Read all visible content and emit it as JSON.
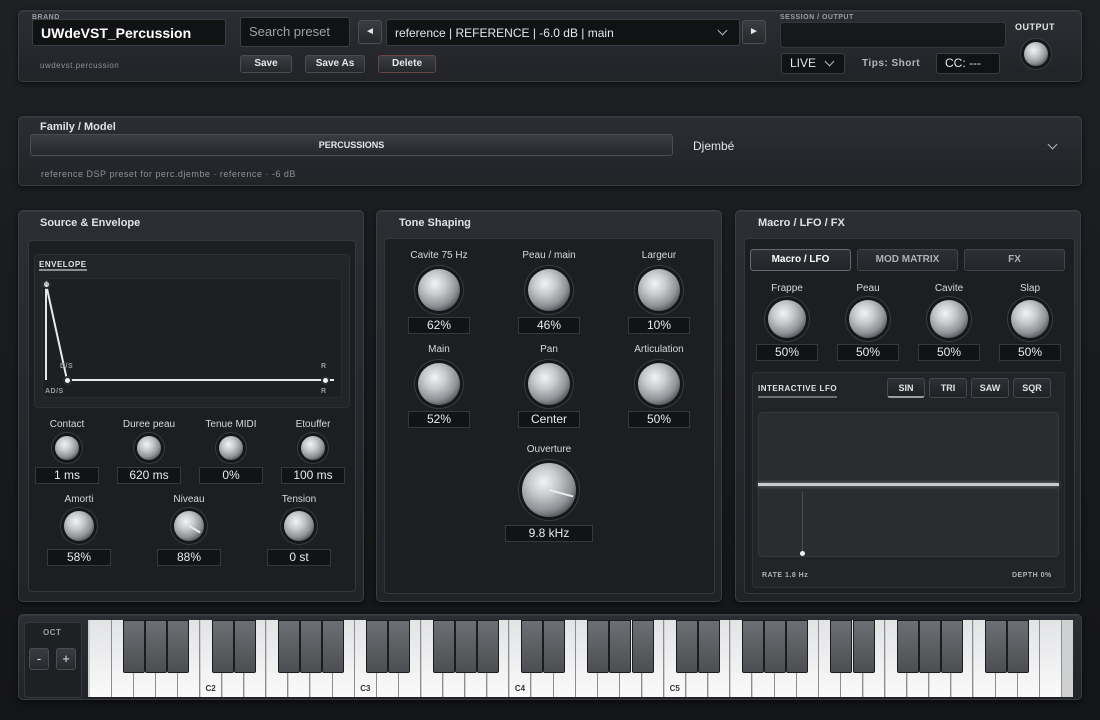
{
  "header": {
    "brand_label": "BRAND",
    "brand_name": "UWdeVST_Percussion",
    "brand_id": "uwdevst.percussion",
    "search_placeholder": "Search preset",
    "preset_name": "reference | REFERENCE | -6.0 dB | main",
    "prev_glyph": "◄",
    "next_glyph": "►",
    "save": "Save",
    "save_as": "Save As",
    "delete": "Delete",
    "session_label": "SESSION / OUTPUT",
    "mode": "LIVE",
    "tips": "Tips: Short",
    "cc": "CC: ---",
    "output_label": "OUTPUT"
  },
  "family": {
    "title": "Family / Model",
    "category": "PERCUSSIONS",
    "model": "Djembé",
    "description": "reference DSP preset for perc.djembe · reference · -6 dB"
  },
  "source": {
    "title": "Source & Envelope",
    "envelope_label": "ENVELOPE",
    "env_points": {
      "a": "A",
      "ds": "D/S",
      "ads": "AD/S",
      "r1": "R",
      "r2": "R"
    },
    "knobs": [
      {
        "label": "Contact",
        "value": "1 ms"
      },
      {
        "label": "Duree peau",
        "value": "620 ms"
      },
      {
        "label": "Tenue MIDI",
        "value": "0%"
      },
      {
        "label": "Etouffer",
        "value": "100 ms"
      },
      {
        "label": "Amorti",
        "value": "58%"
      },
      {
        "label": "Niveau",
        "value": "88%"
      },
      {
        "label": "Tension",
        "value": "0 st"
      }
    ]
  },
  "tone": {
    "title": "Tone Shaping",
    "knobs": [
      {
        "label": "Cavite 75 Hz",
        "value": "62%"
      },
      {
        "label": "Peau / main",
        "value": "46%"
      },
      {
        "label": "Largeur",
        "value": "10%"
      },
      {
        "label": "Main",
        "value": "52%"
      },
      {
        "label": "Pan",
        "value": "Center"
      },
      {
        "label": "Articulation",
        "value": "50%"
      },
      {
        "label": "Ouverture",
        "value": "9.8 kHz"
      }
    ]
  },
  "macro": {
    "title": "Macro / LFO / FX",
    "tabs": [
      "Macro / LFO",
      "MOD MATRIX",
      "FX"
    ],
    "knobs": [
      {
        "label": "Frappe",
        "value": "50%"
      },
      {
        "label": "Peau",
        "value": "50%"
      },
      {
        "label": "Cavite",
        "value": "50%"
      },
      {
        "label": "Slap",
        "value": "50%"
      }
    ],
    "lfo_label": "INTERACTIVE LFO",
    "waves": [
      "SIN",
      "TRI",
      "SAW",
      "SQR"
    ],
    "rate": "RATE 1.8 Hz",
    "depth": "DEPTH 0%"
  },
  "keyboard": {
    "oct_label": "OCT",
    "oct_minus": "-",
    "oct_plus": "+",
    "arrow": "◄",
    "notes": [
      "C2",
      "C3",
      "C4",
      "C5"
    ]
  }
}
